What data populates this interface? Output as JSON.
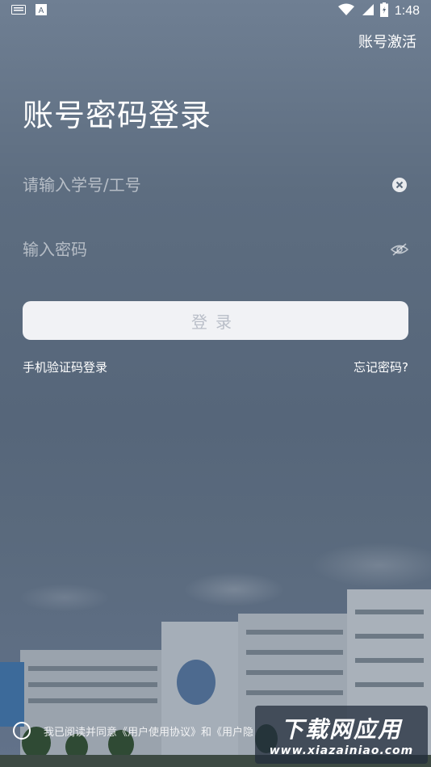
{
  "status_bar": {
    "time": "1:48",
    "icons": [
      "keyboard-icon",
      "a-icon",
      "wifi-icon",
      "signal-icon",
      "battery-icon"
    ]
  },
  "header": {
    "activate_label": "账号激活"
  },
  "title": "账号密码登录",
  "form": {
    "username_placeholder": "请输入学号/工号",
    "password_placeholder": "输入密码",
    "login_label": "登录"
  },
  "links": {
    "sms_login": "手机验证码登录",
    "forgot_password": "忘记密码?"
  },
  "agreement": {
    "text": "我已阅读并同意《用户使用协议》和《用户隐"
  },
  "watermark": {
    "title": "下载网应用",
    "url": "www.xiazainiao.com"
  },
  "colors": {
    "background": "#5b6a7c",
    "button_bg": "#f1f2f5",
    "button_text": "#b9bec8"
  }
}
